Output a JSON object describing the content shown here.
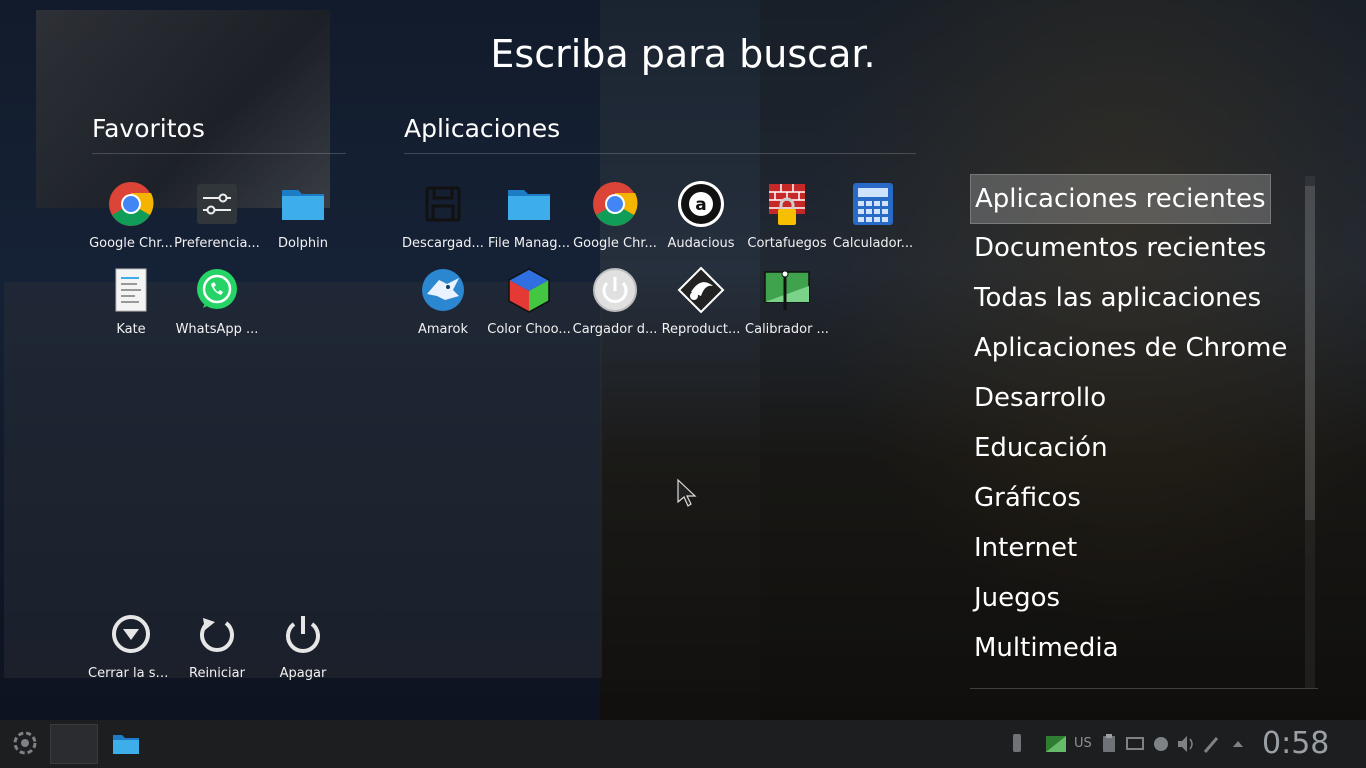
{
  "search": {
    "prompt": "Escriba para buscar."
  },
  "favorites": {
    "title": "Favoritos",
    "items": [
      {
        "label": "Google Chr...",
        "icon": "chrome-icon"
      },
      {
        "label": "Preferencia...",
        "icon": "settings-sliders-icon"
      },
      {
        "label": "Dolphin",
        "icon": "folder-icon"
      },
      {
        "label": "Kate",
        "icon": "text-editor-icon"
      },
      {
        "label": "WhatsApp ...",
        "icon": "whatsapp-icon"
      }
    ]
  },
  "applications": {
    "title": "Aplicaciones",
    "items": [
      {
        "label": "Descargad...",
        "icon": "floppy-icon"
      },
      {
        "label": "File Manag...",
        "icon": "folder-icon"
      },
      {
        "label": "Google Chr...",
        "icon": "chrome-icon"
      },
      {
        "label": "Audacious",
        "icon": "audacious-icon"
      },
      {
        "label": "Cortafuegos",
        "icon": "firewall-icon"
      },
      {
        "label": "Calculador...",
        "icon": "calculator-icon"
      },
      {
        "label": "Amarok",
        "icon": "amarok-wolf-icon"
      },
      {
        "label": "Color Choo...",
        "icon": "color-cube-icon"
      },
      {
        "label": "Cargador d...",
        "icon": "power-loader-icon"
      },
      {
        "label": "Reproduct...",
        "icon": "media-player-icon"
      },
      {
        "label": "Calibrador ...",
        "icon": "calibrator-icon"
      }
    ]
  },
  "session": [
    {
      "label": "Cerrar la se...",
      "icon": "logout-icon"
    },
    {
      "label": "Reiniciar",
      "icon": "restart-icon"
    },
    {
      "label": "Apagar",
      "icon": "power-icon"
    }
  ],
  "categories": [
    "Aplicaciones recientes",
    "Documentos recientes",
    "Todas las aplicaciones",
    "Aplicaciones de Chrome",
    "Desarrollo",
    "Educación",
    "Gráficos",
    "Internet",
    "Juegos",
    "Multimedia"
  ],
  "taskbar": {
    "clock": "0:58",
    "keyboard_layout": "US"
  },
  "colors": {
    "accent": "#3daee9",
    "folder": "#2f95de",
    "panel": "#1d1e20"
  }
}
